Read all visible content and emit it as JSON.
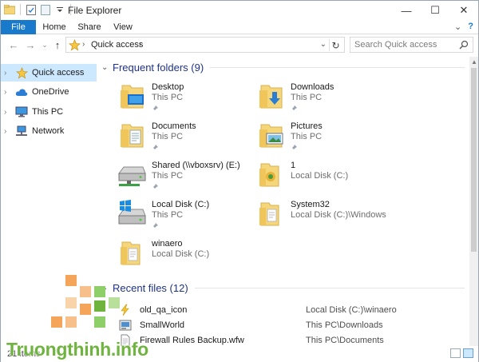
{
  "window": {
    "title": "File Explorer",
    "controls": {
      "minimize": "—",
      "maximize": "☐",
      "close": "✕"
    }
  },
  "ribbon": {
    "tabs": [
      "File",
      "Home",
      "Share",
      "View"
    ],
    "collapse_glyph": "⌄",
    "help_glyph": "?"
  },
  "address": {
    "breadcrumb": "Quick access",
    "search_placeholder": "Search Quick access"
  },
  "nav": {
    "items": [
      {
        "label": "Quick access",
        "icon": "star-icon",
        "selected": true
      },
      {
        "label": "OneDrive",
        "icon": "cloud-icon",
        "selected": false
      },
      {
        "label": "This PC",
        "icon": "monitor-icon",
        "selected": false
      },
      {
        "label": "Network",
        "icon": "network-icon",
        "selected": false
      }
    ]
  },
  "frequent": {
    "title": "Frequent folders (9)",
    "folders": [
      {
        "name": "Desktop",
        "location": "This PC",
        "pinned": true,
        "icon": "desktop-folder-icon"
      },
      {
        "name": "Downloads",
        "location": "This PC",
        "pinned": true,
        "icon": "downloads-folder-icon"
      },
      {
        "name": "Documents",
        "location": "This PC",
        "pinned": true,
        "icon": "documents-folder-icon"
      },
      {
        "name": "Pictures",
        "location": "This PC",
        "pinned": true,
        "icon": "pictures-folder-icon"
      },
      {
        "name": "Shared (\\\\vboxsrv) (E:)",
        "location": "This PC",
        "pinned": true,
        "icon": "network-drive-icon"
      },
      {
        "name": "1",
        "location": "Local Disk (C:)",
        "pinned": false,
        "icon": "folder-icon"
      },
      {
        "name": "Local Disk (C:)",
        "location": "This PC",
        "pinned": true,
        "icon": "windows-drive-icon"
      },
      {
        "name": "System32",
        "location": "Local Disk (C:)\\Windows",
        "pinned": false,
        "icon": "folder-icon"
      },
      {
        "name": "winaero",
        "location": "Local Disk (C:)",
        "pinned": false,
        "icon": "folder-icon"
      }
    ]
  },
  "recent": {
    "title": "Recent files (12)",
    "files": [
      {
        "name": "old_qa_icon",
        "location": "Local Disk (C:)\\winaero",
        "icon": "lightning-file-icon"
      },
      {
        "name": "SmallWorld",
        "location": "This PC\\Downloads",
        "icon": "installer-file-icon"
      },
      {
        "name": "Firewall Rules Backup.wfw",
        "location": "This PC\\Documents",
        "icon": "document-file-icon"
      }
    ]
  },
  "status": {
    "count": "21 items"
  },
  "watermark": {
    "text": "Truongthinh.info"
  },
  "colors": {
    "file_tab": "#1979ca",
    "selection": "#cce8ff",
    "group_title": "#1e3287",
    "folder": "#f6d67a",
    "watermark_green": "#6fb43f",
    "watermark_orange": "#f5a55a"
  }
}
